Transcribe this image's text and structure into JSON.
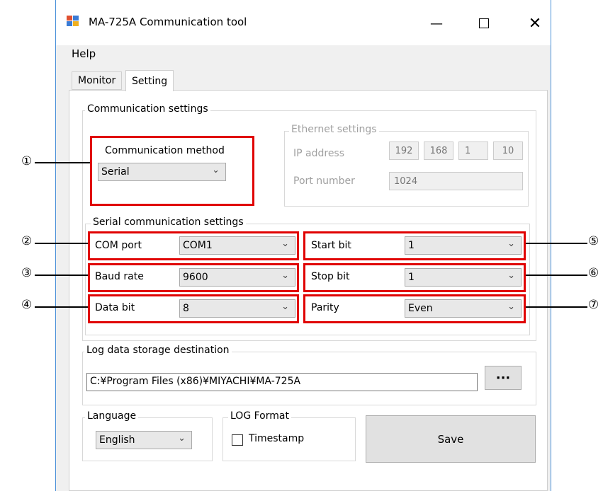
{
  "window": {
    "title": "MA-725A Communication tool"
  },
  "menu": {
    "help": "Help"
  },
  "tabs": [
    {
      "label": "Monitor"
    },
    {
      "label": "Setting"
    }
  ],
  "comm": {
    "group_label": "Communication settings",
    "method_label": "Communication method",
    "method_value": "Serial",
    "ethernet": {
      "group_label": "Ethernet settings",
      "ip_label": "IP address",
      "ip": [
        "192",
        "168",
        "1",
        "10"
      ],
      "port_label": "Port number",
      "port_value": "1024"
    }
  },
  "serial": {
    "group_label": "Serial communication settings",
    "com_port_label": "COM port",
    "com_port_value": "COM1",
    "baud_label": "Baud rate",
    "baud_value": "9600",
    "data_bit_label": "Data bit",
    "data_bit_value": "8",
    "start_bit_label": "Start bit",
    "start_bit_value": "1",
    "stop_bit_label": "Stop bit",
    "stop_bit_value": "1",
    "parity_label": "Parity",
    "parity_value": "Even"
  },
  "log": {
    "group_label": "Log data storage destination",
    "path": "C:¥Program Files (x86)¥MIYACHI¥MA-725A",
    "browse_label": "···"
  },
  "language": {
    "group_label": "Language",
    "value": "English"
  },
  "log_format": {
    "group_label": "LOG Format",
    "timestamp_label": "Timestamp",
    "timestamp_checked": false
  },
  "save_label": "Save",
  "callouts": [
    "①",
    "②",
    "③",
    "④",
    "⑤",
    "⑥",
    "⑦"
  ],
  "colors": {
    "highlight": "#e00000",
    "window_border": "#4a90d9"
  }
}
